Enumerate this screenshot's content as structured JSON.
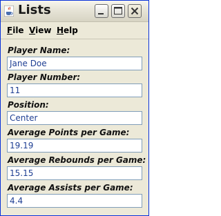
{
  "window": {
    "title": "Lists"
  },
  "menu": {
    "file": {
      "mnemonic": "F",
      "rest": "ile"
    },
    "view": {
      "mnemonic": "V",
      "rest": "iew"
    },
    "help": {
      "mnemonic": "H",
      "rest": "elp"
    }
  },
  "fields": [
    {
      "label": "Player Name:",
      "value": "Jane Doe"
    },
    {
      "label": "Player Number:",
      "value": "11"
    },
    {
      "label": "Position:",
      "value": "Center"
    },
    {
      "label": "Average Points per Game:",
      "value": "19.19"
    },
    {
      "label": "Average Rebounds per Game:",
      "value": "15.15"
    },
    {
      "label": "Average Assists per Game:",
      "value": "4.4"
    }
  ],
  "icons": {
    "app": "java-cup-icon",
    "minimize": "minimize-icon",
    "maximize": "maximize-icon",
    "close": "close-icon"
  }
}
